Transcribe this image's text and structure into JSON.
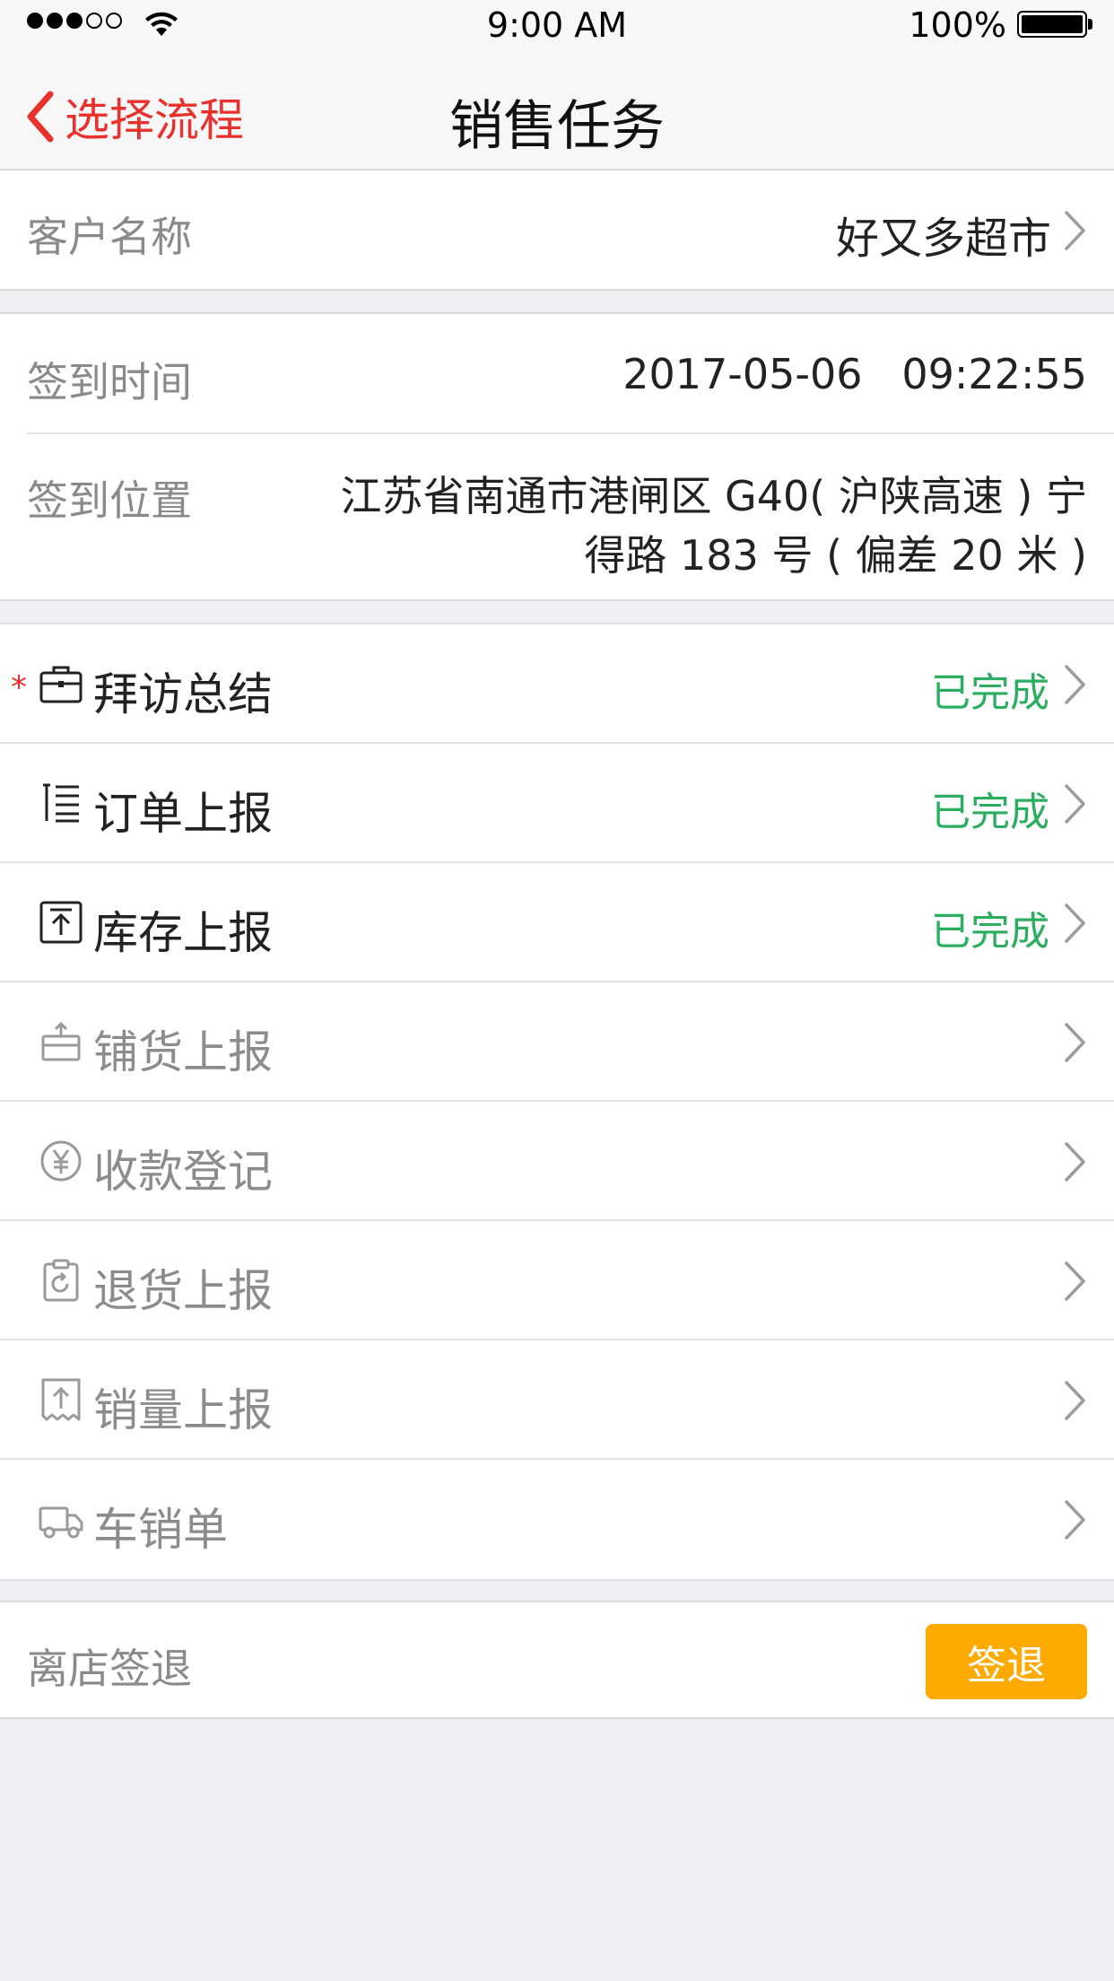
{
  "status_bar": {
    "time": "9:00 AM",
    "battery": "100%",
    "signal_icon": "signal-dots-icon",
    "wifi_icon": "wifi-icon",
    "battery_icon": "battery-icon"
  },
  "nav": {
    "back_label": "选择流程",
    "title": "销售任务",
    "accent_color": "#e8312c"
  },
  "customer": {
    "label": "客户名称",
    "value": "好又多超市"
  },
  "checkin": {
    "time_label": "签到时间",
    "time_value": "2017-05-06   09:22:55",
    "location_label": "签到位置",
    "location_value": "江苏省南通市港闸区 G40( 沪陕高速 ) 宁得路 183 号 ( 偏差 20 米 )"
  },
  "tasks": [
    {
      "label": "拜访总结",
      "status": "已完成",
      "required": "*",
      "icon": "briefcase-icon"
    },
    {
      "label": "订单上报",
      "status": "已完成",
      "icon": "list-icon"
    },
    {
      "label": "库存上报",
      "status": "已完成",
      "icon": "upload-box-icon"
    },
    {
      "label": "铺货上报",
      "status": "",
      "icon": "shelf-icon"
    },
    {
      "label": "收款登记",
      "status": "",
      "icon": "yen-coin-icon"
    },
    {
      "label": "退货上报",
      "status": "",
      "icon": "return-clipboard-icon"
    },
    {
      "label": "销量上报",
      "status": "",
      "icon": "sales-upload-icon"
    },
    {
      "label": "车销单",
      "status": "",
      "icon": "truck-icon"
    }
  ],
  "status_color": "#2bae5f",
  "checkout": {
    "label": "离店签退",
    "button_label": "签退",
    "button_color": "#ffaa00"
  }
}
